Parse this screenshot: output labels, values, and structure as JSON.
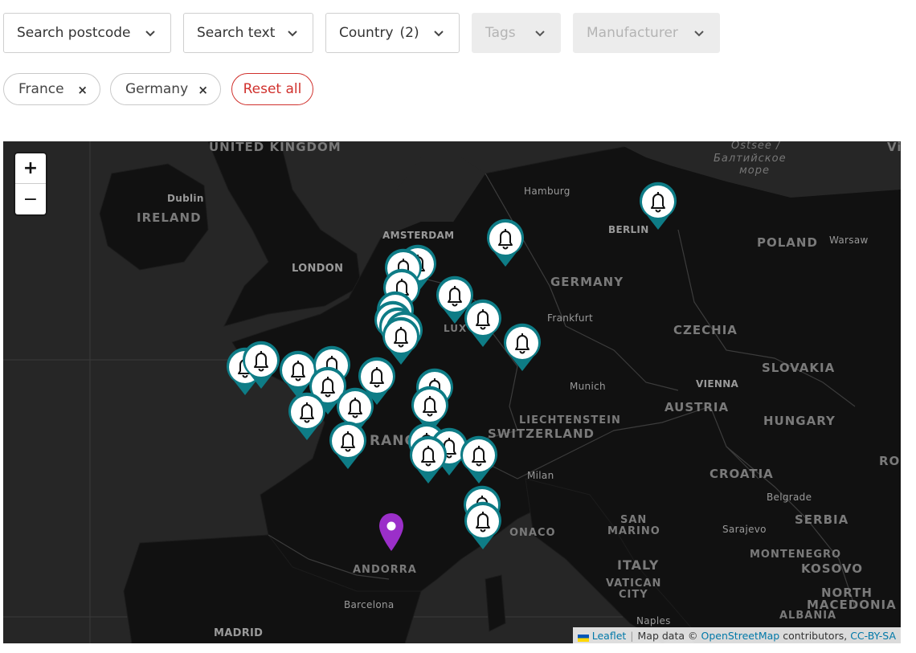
{
  "filters": {
    "postcode": "Search postcode",
    "text": "Search text",
    "country_label": "Country",
    "country_count": "(2)",
    "tags": "Tags",
    "manufacturer": "Manufacturer"
  },
  "chips": {
    "france": "France",
    "germany": "Germany",
    "reset": "Reset all",
    "remove_symbol": "×"
  },
  "map": {
    "zoom_in": "+",
    "zoom_out": "−",
    "labels": {
      "uk": "UNITED KINGDOM",
      "ireland": "IRELAND",
      "dublin": "Dublin",
      "london": "LONDON",
      "amsterdam": "AMSTERDAM",
      "hamburg": "Hamburg",
      "berlin": "BERLIN",
      "ostsee": "Ostsee /",
      "baltic1": "Балтийское",
      "baltic2": "море",
      "vi": "Vi",
      "poland": "POLAND",
      "warsaw": "Warsaw",
      "germany": "GERMANY",
      "lux": "LUX",
      "frankfurt": "Frankfurt",
      "czechia": "CZECHIA",
      "slovakia": "SLOVAKIA",
      "munich": "Munich",
      "vienna": "VIENNA",
      "austria": "AUSTRIA",
      "hungary": "HUNGARY",
      "liechtenstein": "LIECHTENSTEIN",
      "switzerland": "SWITZERLAND",
      "france_partial": "RANC",
      "ro": "RO",
      "milan": "Milan",
      "croatia": "CROATIA",
      "belgrade": "Belgrade",
      "serbia": "SERBIA",
      "sarajevo": "Sarajevo",
      "monaco": "ONACO",
      "san_marino1": "SAN",
      "san_marino2": "MARINO",
      "montenegro": "MONTENEGRO",
      "kosovo": "KOSOVO",
      "italy": "ITALY",
      "vatican1": "VATICAN",
      "vatican2": "CITY",
      "andorra": "ANDORRA",
      "barcelona": "Barcelona",
      "north_mac1": "NORTH",
      "north_mac2": "MACEDONIA",
      "albania": "ALBANIA",
      "naples": "Naples",
      "madrid": "MADRID",
      "germany_bottom": "GERMANY"
    },
    "marker_color": "#0e7c86",
    "location_color": "#9b2fc9",
    "bell_markers": 34,
    "location_markers": 1
  },
  "attribution": {
    "leaflet": "Leaflet",
    "sep": "|",
    "mapdata": "Map data ©",
    "osm": "OpenStreetMap",
    "contributors": "contributors,",
    "license": "CC-BY-SA"
  }
}
